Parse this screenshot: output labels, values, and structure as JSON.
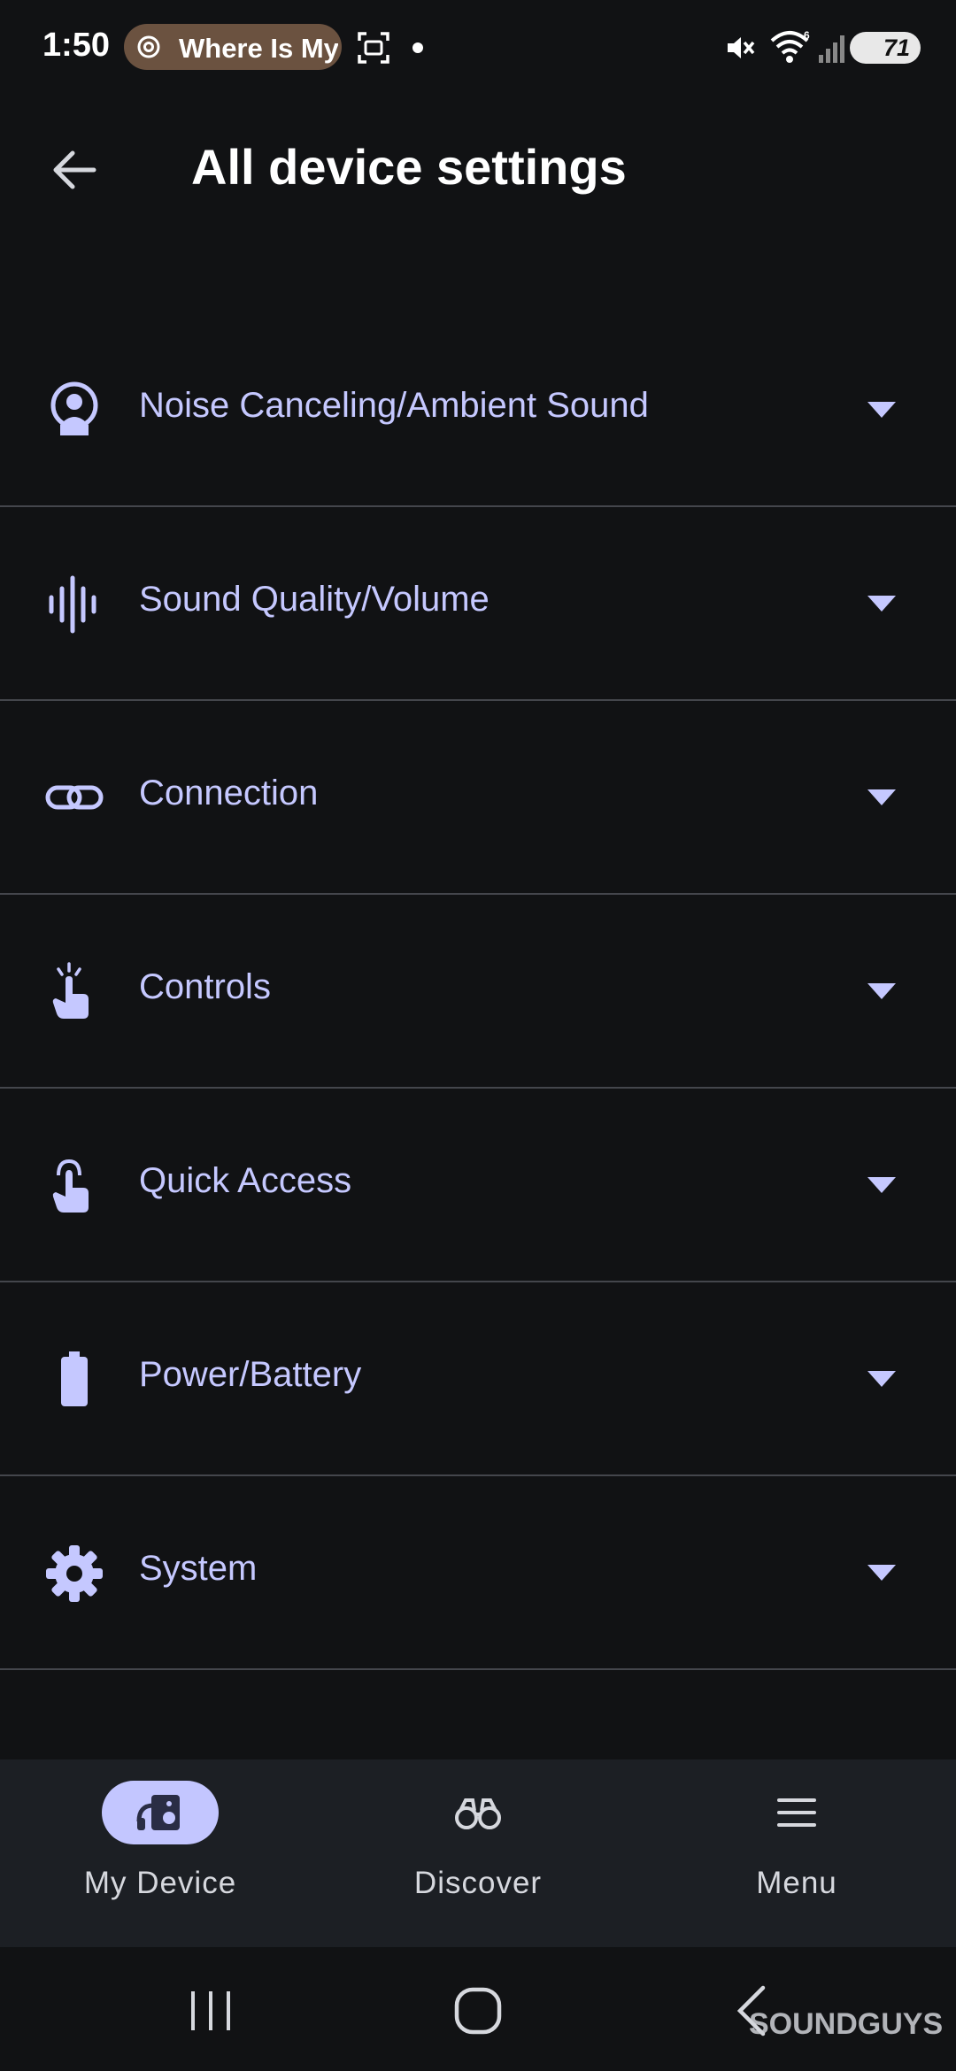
{
  "status_bar": {
    "time": "1:50",
    "notification_pill_text": "Where Is My",
    "battery_level": "71",
    "colors": {
      "pill_bg": "#6b5240"
    }
  },
  "header": {
    "title": "All device settings"
  },
  "settings": [
    {
      "label": "Noise Canceling/Ambient Sound",
      "icon": "noise-canceling-icon"
    },
    {
      "label": "Sound Quality/Volume",
      "icon": "sound-wave-icon"
    },
    {
      "label": "Connection",
      "icon": "link-icon"
    },
    {
      "label": "Controls",
      "icon": "tap-gesture-icon"
    },
    {
      "label": "Quick Access",
      "icon": "touch-hand-icon"
    },
    {
      "label": "Power/Battery",
      "icon": "battery-icon"
    },
    {
      "label": "System",
      "icon": "gear-icon"
    }
  ],
  "bottom_nav": {
    "items": [
      {
        "label": "My Device",
        "icon": "device-speaker-icon",
        "active": true
      },
      {
        "label": "Discover",
        "icon": "binoculars-icon",
        "active": false
      },
      {
        "label": "Menu",
        "icon": "hamburger-menu-icon",
        "active": false
      }
    ]
  },
  "watermark": "SOUNDGUYS",
  "colors": {
    "background": "#111214",
    "label": "#c5c8ff",
    "divider": "#44464c",
    "nav_bg": "#1c1f24",
    "nav_active_pill": "#c3c6ff"
  }
}
